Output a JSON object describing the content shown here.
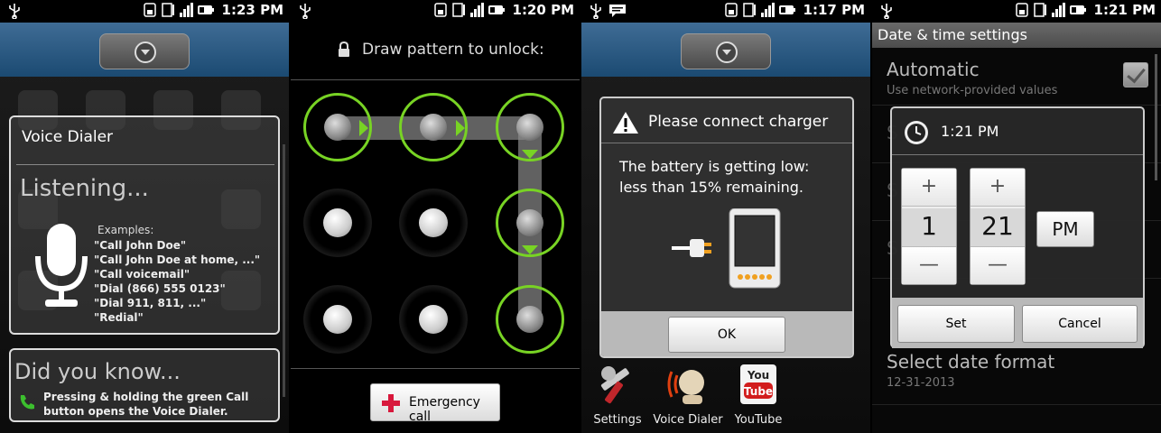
{
  "status_times": [
    "1:23 PM",
    "1:20 PM",
    "1:17 PM",
    "1:21 PM"
  ],
  "voice_dialer": {
    "title": "Voice Dialer",
    "listening": "Listening...",
    "examples_label": "Examples:",
    "examples": [
      "\"Call John Doe\"",
      "\"Call John Doe at home, ...\"",
      "\"Call voicemail\"",
      "\"Dial (866) 555 0123\"",
      "\"Dial 911, 811, ...\"",
      "\"Redial\""
    ],
    "did_you_know_title": "Did you know...",
    "did_you_know_text": "Pressing & holding the green Call button opens the Voice Dialer."
  },
  "lock_screen": {
    "title": "Draw pattern to unlock:",
    "emergency_label": "Emergency call"
  },
  "battery_dialog": {
    "title": "Please connect charger",
    "message_line1": "The battery is getting low:",
    "message_line2": "less than 15% remaining.",
    "ok_label": "OK"
  },
  "dock": [
    {
      "label": "Settings",
      "icon": "settings-icon"
    },
    {
      "label": "Voice Dialer",
      "icon": "voice-dialer-icon"
    },
    {
      "label": "YouTube",
      "icon": "youtube-icon"
    }
  ],
  "date_time": {
    "header": "Date & time settings",
    "automatic_title": "Automatic",
    "automatic_sub": "Use network-provided values",
    "automatic_checked": true,
    "dialog_title": "1:21 PM",
    "hour": "1",
    "minute": "21",
    "ampm": "PM",
    "plus": "+",
    "minus": "—",
    "set_label": "Set",
    "cancel_label": "Cancel",
    "date_format_title": "Select date format",
    "date_format_value": "12-31-2013"
  },
  "colors": {
    "pattern_green": "#78d324",
    "dialog_border": "#cccccc",
    "home_top": "#2a5b85"
  }
}
